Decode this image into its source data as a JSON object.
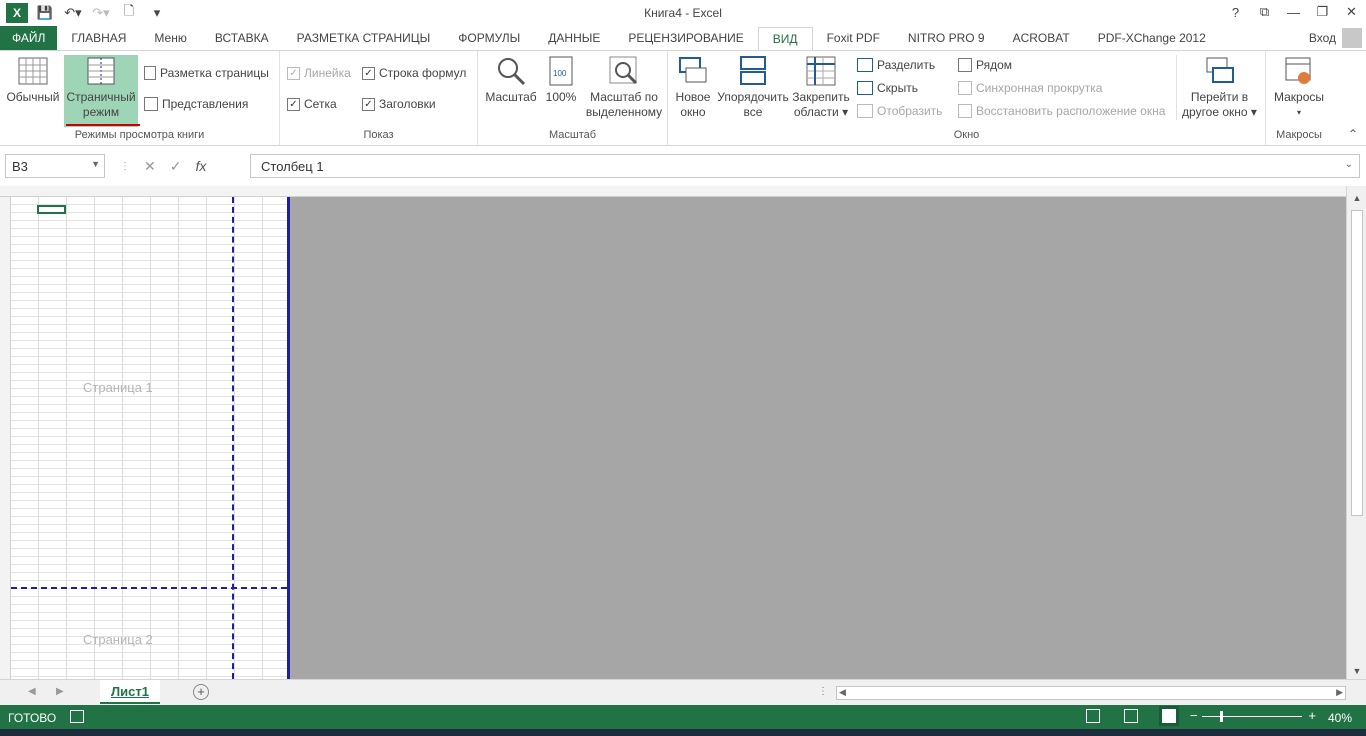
{
  "window": {
    "title": "Книга4 - Excel",
    "controls": [
      "?",
      "⧉",
      "—",
      "❐",
      "✕"
    ]
  },
  "tabs": {
    "file": "ФАЙЛ",
    "items": [
      "ГЛАВНАЯ",
      "Меню",
      "ВСТАВКА",
      "РАЗМЕТКА СТРАНИЦЫ",
      "ФОРМУЛЫ",
      "ДАННЫЕ",
      "РЕЦЕНЗИРОВАНИЕ",
      "ВИД",
      "Foxit PDF",
      "NITRO PRO 9",
      "ACROBAT",
      "PDF-XChange 2012"
    ],
    "active": "ВИД",
    "signin": "Вход"
  },
  "ribbon": {
    "views": {
      "label": "Режимы просмотра книги",
      "normal": "Обычный",
      "pagebreak_1": "Страничный",
      "pagebreak_2": "режим",
      "page_layout": "Разметка страницы",
      "custom": "Представления"
    },
    "show": {
      "label": "Показ",
      "ruler": "Линейка",
      "formula_bar": "Строка формул",
      "gridlines": "Сетка",
      "headings": "Заголовки"
    },
    "zoom": {
      "label": "Масштаб",
      "zoom": "Масштаб",
      "zoom100": "100%",
      "sel_1": "Масштаб по",
      "sel_2": "выделенному"
    },
    "window": {
      "label": "Окно",
      "new_1": "Новое",
      "new_2": "окно",
      "arrange_1": "Упорядочить",
      "arrange_2": "все",
      "freeze_1": "Закрепить",
      "freeze_2": "области ▾",
      "split": "Разделить",
      "hide": "Скрыть",
      "unhide": "Отобразить",
      "side": "Рядом",
      "sync": "Синхронная прокрутка",
      "reset": "Восстановить расположение окна",
      "switch_1": "Перейти в",
      "switch_2": "другое окно ▾"
    },
    "macros": {
      "label": "Макросы",
      "macros": "Макросы"
    }
  },
  "formula_bar": {
    "name_box": "B3",
    "cancel": "✕",
    "enter": "✓",
    "fx": "fx",
    "content": "Столбец 1"
  },
  "sheet": {
    "page1": "Страница 1",
    "page2": "Страница 2"
  },
  "sheet_tabs": {
    "active": "Лист1",
    "add": "+"
  },
  "status": {
    "ready": "ГОТОВО",
    "zoom": "40%"
  }
}
